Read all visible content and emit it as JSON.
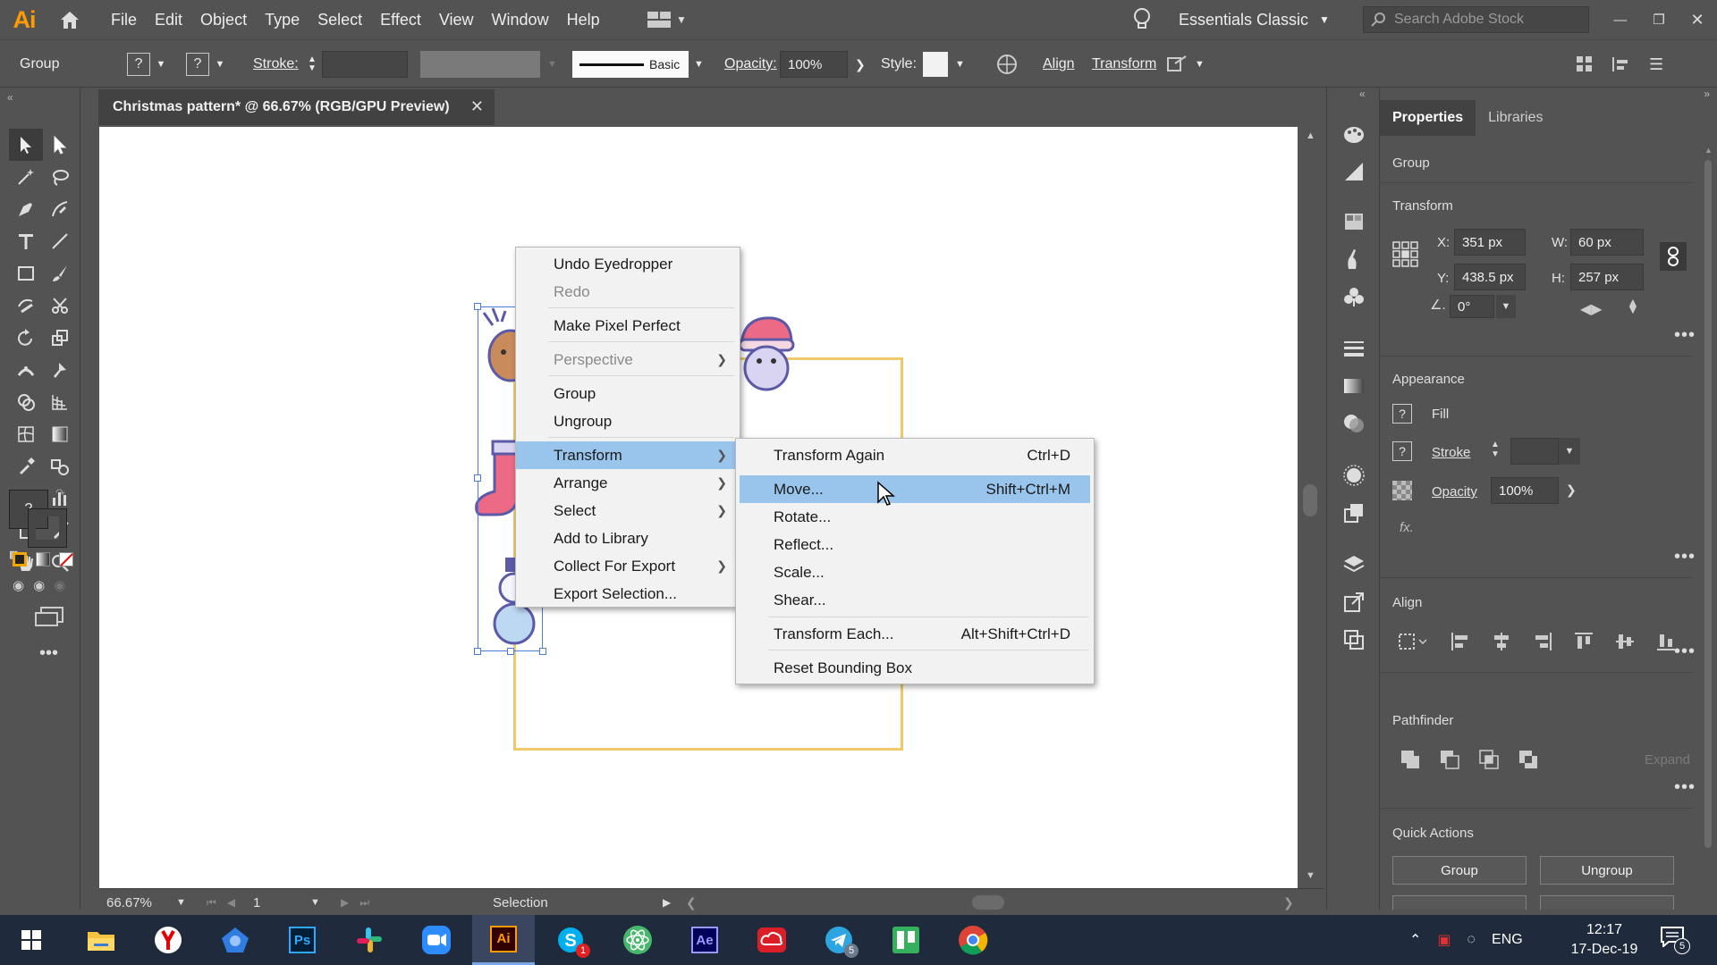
{
  "app": {
    "logo": "Ai",
    "workspace": "Essentials Classic",
    "search_placeholder": "Search Adobe Stock"
  },
  "menubar": {
    "items": [
      "File",
      "Edit",
      "Object",
      "Type",
      "Select",
      "Effect",
      "View",
      "Window",
      "Help"
    ]
  },
  "control_bar": {
    "selection_type": "Group",
    "fill_placeholder": "?",
    "stroke_placeholder": "?",
    "stroke_label": "Stroke:",
    "brush_label": "Basic",
    "opacity_label": "Opacity:",
    "opacity_value": "100%",
    "style_label": "Style:",
    "align_label": "Align",
    "transform_label": "Transform"
  },
  "document": {
    "tab_title": "Christmas pattern* @ 66.67% (RGB/GPU Preview)",
    "zoom": "66.67%",
    "artboard_number": "1",
    "status_tool": "Selection"
  },
  "tools": {
    "fill_stroke_placeholder": "?"
  },
  "context_menu": {
    "items": [
      {
        "label": "Undo Eyedropper",
        "disabled": false
      },
      {
        "label": "Redo",
        "disabled": true
      },
      {
        "label": "Make Pixel Perfect",
        "disabled": false
      },
      {
        "label": "Perspective",
        "disabled": true
      },
      {
        "label": "Group",
        "disabled": false
      },
      {
        "label": "Ungroup",
        "disabled": false
      },
      {
        "label": "Transform",
        "highlighted": true
      },
      {
        "label": "Arrange"
      },
      {
        "label": "Select"
      },
      {
        "label": "Add to Library"
      },
      {
        "label": "Collect For Export"
      },
      {
        "label": "Export Selection..."
      }
    ]
  },
  "submenu": {
    "items": [
      {
        "label": "Transform Again",
        "shortcut": "Ctrl+D"
      },
      {
        "label": "Move...",
        "shortcut": "Shift+Ctrl+M",
        "highlighted": true
      },
      {
        "label": "Rotate...",
        "shortcut": ""
      },
      {
        "label": "Reflect...",
        "shortcut": ""
      },
      {
        "label": "Scale...",
        "shortcut": ""
      },
      {
        "label": "Shear...",
        "shortcut": ""
      },
      {
        "label": "Transform Each...",
        "shortcut": "Alt+Shift+Ctrl+D"
      },
      {
        "label": "Reset Bounding Box",
        "shortcut": ""
      }
    ]
  },
  "properties": {
    "tabs": [
      "Properties",
      "Libraries"
    ],
    "selection": "Group",
    "transform": {
      "title": "Transform",
      "x_label": "X:",
      "x": "351 px",
      "y_label": "Y:",
      "y": "438.5 px",
      "w_label": "W:",
      "w": "60 px",
      "h_label": "H:",
      "h": "257 px",
      "angle": "0°"
    },
    "appearance": {
      "title": "Appearance",
      "fill_label": "Fill",
      "stroke_label": "Stroke",
      "opacity_label": "Opacity",
      "opacity_value": "100%",
      "fx_label": "fx.",
      "placeholder": "?"
    },
    "align": {
      "title": "Align"
    },
    "pathfinder": {
      "title": "Pathfinder",
      "expand_label": "Expand"
    },
    "quick_actions": {
      "title": "Quick Actions",
      "group_button": "Group",
      "ungroup_button": "Ungroup"
    }
  },
  "taskbar": {
    "time": "12:17",
    "date": "17-Dec-19",
    "language": "ENG",
    "notification_count": "5",
    "skype_badge": "1",
    "telegram_badge": "5",
    "ps_label": "Ps",
    "ai_label": "Ai",
    "ae_label": "Ae"
  },
  "colors": {
    "accent_highlight": "#99c5ec",
    "artboard_border": "#f0c96a",
    "ai_orange": "#ff9a00"
  }
}
